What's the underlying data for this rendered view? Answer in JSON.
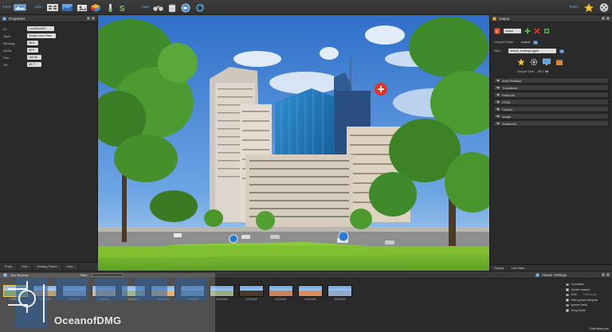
{
  "toolbar": {
    "input_label": "Input:",
    "edit_label": "Edit:",
    "view_label": "View:",
    "tools_label": "Tools:"
  },
  "properties": {
    "title": "Properties",
    "rows": [
      {
        "label": "ID:",
        "value": "LocalSouth01"
      },
      {
        "label": "Type:",
        "value": "Simple Lens Flare"
      },
      {
        "label": "Blinding:",
        "value": "80%"
      },
      {
        "label": "Alpha:",
        "value": "80%"
      },
      {
        "label": "Pan:",
        "value": "160.66"
      },
      {
        "label": "Tilt:",
        "value": "56.77"
      }
    ]
  },
  "output": {
    "title": "Output",
    "output_name": "output",
    "output_folder_label": "Output Folder:",
    "output_folder_value": "output",
    "skin_label": "Skin:",
    "skin_value": "default_loadingui.ggsk",
    "output_size_label": "Output Size:",
    "output_size_value": "20.7 kB",
    "sections": [
      "Auto Rotation",
      "Transitions",
      "Hotspots",
      "HTML",
      "Control",
      "Image",
      "Advanced"
    ],
    "bottom_tabs": [
      "Output",
      "List View"
    ]
  },
  "panel_tabs": [
    "Proje...",
    "Ove...",
    "Viewing Param...",
    "User..."
  ],
  "tour_browser": {
    "title": "Tour Browser",
    "filter_label": "Filter:",
    "thumbnails": [
      {
        "caption": "00020478",
        "color": "#6a8c5a"
      },
      {
        "caption": "00020479",
        "color": "#b08a56"
      },
      {
        "caption": "00020480",
        "color": "#7a9bbd"
      },
      {
        "caption": "00020481",
        "color": "#c4a676"
      },
      {
        "caption": "00020482",
        "color": "#8aa27a"
      },
      {
        "caption": "00020483",
        "color": "#d8a35c"
      },
      {
        "caption": "00020484",
        "color": "#6e94b8"
      },
      {
        "caption": "00020485",
        "color": "#9aae86"
      },
      {
        "caption": "00020486",
        "color": "#4b3a2c"
      },
      {
        "caption": "00020487",
        "color": "#c9835a"
      },
      {
        "caption": "00020488",
        "color": "#d98e5a"
      },
      {
        "caption": "00020489",
        "color": "#8fa7c8"
      }
    ]
  },
  "viewer_settings": {
    "title": "Viewer Settings",
    "items": [
      "Compass",
      "Center marker",
      "Grid",
      "Hide ghost hotspots",
      "Ignore limits",
      "Drag Mode"
    ],
    "grid_extra": "Grid angle",
    "footer": "Trial Mode.pre"
  },
  "watermark": {
    "text": "OceanofDMG"
  },
  "colors": {
    "accent_blue": "#5aaeea",
    "hotspot_red": "#e0342a",
    "sky": "#3b7ed3"
  }
}
